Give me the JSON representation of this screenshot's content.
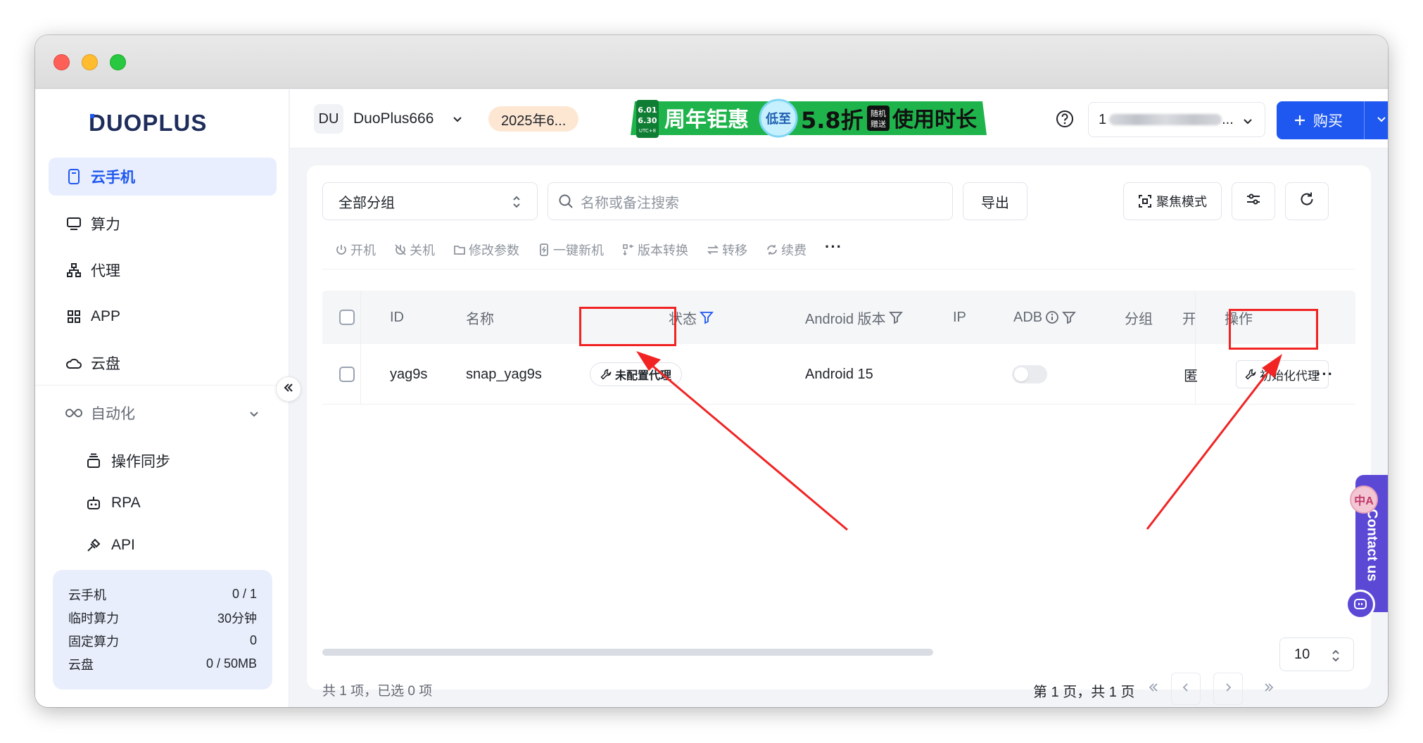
{
  "sidebar": {
    "logo": "DUOPLUS",
    "nav": [
      {
        "label": "云手机",
        "icon": "phone-icon",
        "active": true
      },
      {
        "label": "算力",
        "icon": "monitor-icon",
        "active": false
      },
      {
        "label": "代理",
        "icon": "proxy-icon",
        "active": false
      },
      {
        "label": "APP",
        "icon": "apps-grid-icon",
        "active": false
      },
      {
        "label": "云盘",
        "icon": "cloud-icon",
        "active": false
      }
    ],
    "automation": {
      "label": "自动化",
      "items": [
        {
          "label": "操作同步",
          "icon": "sync-icon"
        },
        {
          "label": "RPA",
          "icon": "robot-icon"
        },
        {
          "label": "API",
          "icon": "plug-icon"
        }
      ]
    },
    "stats": [
      {
        "label": "云手机",
        "value": "0 / 1"
      },
      {
        "label": "临时算力",
        "value": "30分钟"
      },
      {
        "label": "固定算力",
        "value": "0"
      },
      {
        "label": "云盘",
        "value": "0 / 50MB"
      }
    ]
  },
  "header": {
    "workspace_avatar": "DU",
    "workspace_name": "DuoPlus666",
    "date_pill": "2025年6...",
    "banner": {
      "dates": [
        "6.01",
        "6.30"
      ],
      "tz": "UTC+8",
      "text1": "周年钜惠",
      "badge": "低至",
      "discount": "5.8折",
      "tag": [
        "随机",
        "赠送"
      ],
      "text2": "使用时长"
    },
    "account_prefix": "1",
    "account_suffix": "...",
    "buy_label": "购买"
  },
  "toolbar": {
    "group_select": "全部分组",
    "search_placeholder": "名称或备注搜索",
    "export_label": "导出",
    "focus_label": "聚焦模式"
  },
  "actions": [
    "开机",
    "关机",
    "修改参数",
    "一键新机",
    "版本转换",
    "转移",
    "续费"
  ],
  "table": {
    "columns": [
      "ID",
      "名称",
      "状态",
      "Android 版本",
      "IP",
      "ADB",
      "分组",
      "开",
      "操作"
    ],
    "rows": [
      {
        "id": "yag9s",
        "name": "snap_yag9s",
        "status": "未配置代理",
        "android": "Android 15",
        "ip": "",
        "adb": false,
        "group_cell": "",
        "open_cell": "匿",
        "action": "初始化代理"
      }
    ]
  },
  "footer": {
    "count_text": "共 1 项，已选 0 项",
    "page_text": "第 1 页，共 1 页",
    "page_size": "10"
  },
  "floating": {
    "contact": "Contact us",
    "translate": "中A"
  },
  "colors": {
    "primary": "#1f58f0",
    "highlight": "#f12323",
    "banner_green": "#1fb44b",
    "contact_purple": "#5b49d6"
  }
}
